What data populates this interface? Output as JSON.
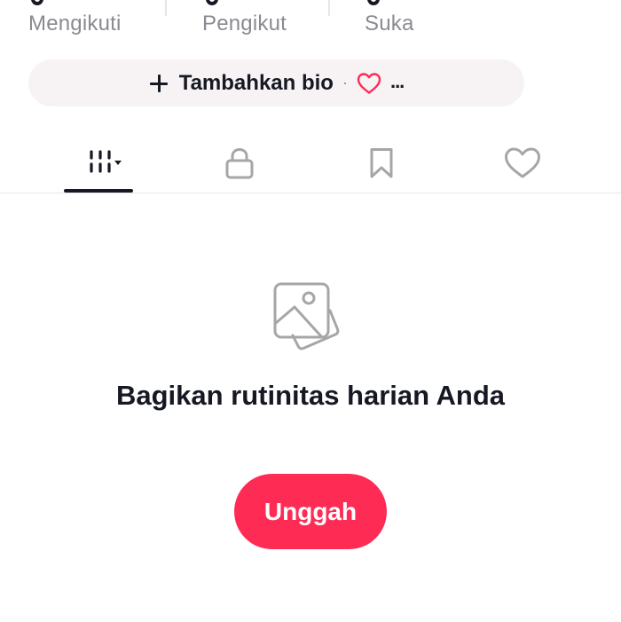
{
  "stats": {
    "following_label": "Mengikuti",
    "followers_label": "Pengikut",
    "likes_label": "Suka"
  },
  "bio": {
    "add_bio_label": "Tambahkan bio",
    "separator": "·",
    "more_label": "...",
    "heart_color": "#fe2c55",
    "pill_color": "#f7f3f5"
  },
  "tabs": [
    {
      "name": "videos",
      "icon": "video-grid-icon",
      "selected": true
    },
    {
      "name": "private",
      "icon": "lock-icon",
      "selected": false
    },
    {
      "name": "saved",
      "icon": "bookmark-icon",
      "selected": false
    },
    {
      "name": "liked",
      "icon": "heart-icon",
      "selected": false
    }
  ],
  "empty_state": {
    "icon": "photos-icon",
    "title": "Bagikan rutinitas harian Anda",
    "upload_label": "Unggah"
  },
  "colors": {
    "accent": "#fe2c55",
    "text": "#161823",
    "muted": "#8a8b91",
    "icon_gray": "#a6a6a9"
  }
}
